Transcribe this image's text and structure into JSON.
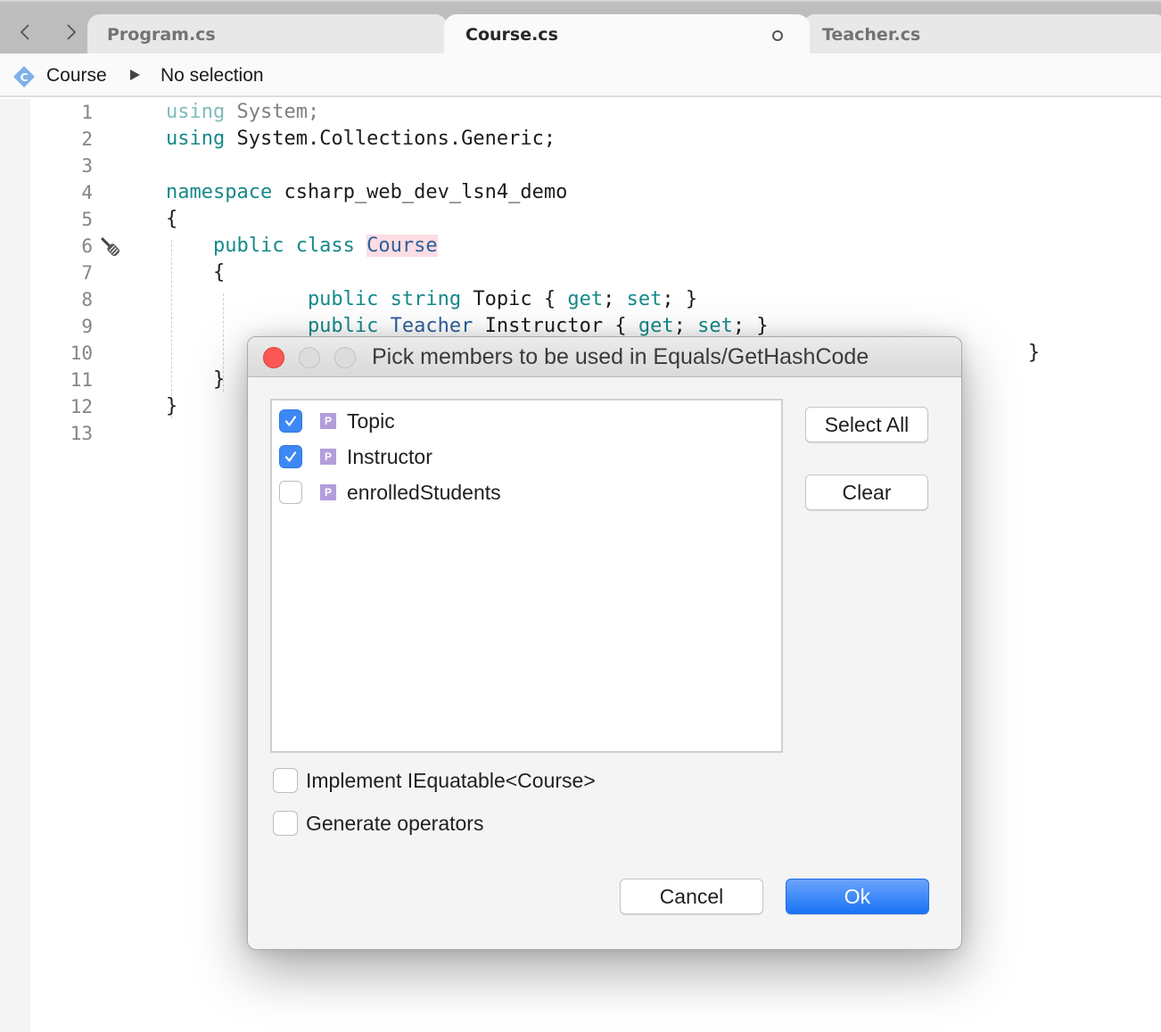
{
  "tabs": {
    "items": [
      {
        "label": "Program.cs",
        "active": false
      },
      {
        "label": "Course.cs",
        "active": true,
        "unsaved": true
      },
      {
        "label": "Teacher.cs",
        "active": false
      }
    ],
    "nav_back_icon": "chevron-left-icon",
    "nav_forward_icon": "chevron-right-icon"
  },
  "breadcrumb": {
    "class_icon_letter": "C",
    "class_name": "Course",
    "selection": "No selection"
  },
  "editor": {
    "line_numbers": [
      "1",
      "2",
      "3",
      "4",
      "5",
      "6",
      "7",
      "8",
      "9",
      "10",
      "11",
      "12",
      "13"
    ],
    "lines": [
      [
        {
          "t": "using",
          "c": "kw-dim"
        },
        {
          "t": " System;",
          "c": "dim"
        }
      ],
      [
        {
          "t": "using",
          "c": "kw"
        },
        {
          "t": " System.Collections.Generic;",
          "c": ""
        }
      ],
      [],
      [
        {
          "t": "namespace",
          "c": "kw"
        },
        {
          "t": " csharp_web_dev_lsn4_demo",
          "c": ""
        }
      ],
      [
        {
          "t": "{",
          "c": ""
        }
      ],
      [
        {
          "t": "    public class ",
          "c": "kw"
        },
        {
          "t": "Course",
          "c": "type hl"
        }
      ],
      [
        {
          "t": "    {",
          "c": ""
        }
      ],
      [
        {
          "t": "            public string",
          "c": "kw"
        },
        {
          "t": " Topic { ",
          "c": ""
        },
        {
          "t": "get",
          "c": "kw"
        },
        {
          "t": "; ",
          "c": ""
        },
        {
          "t": "set",
          "c": "kw"
        },
        {
          "t": "; }",
          "c": ""
        }
      ],
      [
        {
          "t": "            public ",
          "c": "kw"
        },
        {
          "t": "Teacher",
          "c": "type"
        },
        {
          "t": " Instructor { ",
          "c": ""
        },
        {
          "t": "get",
          "c": "kw"
        },
        {
          "t": "; ",
          "c": ""
        },
        {
          "t": "set",
          "c": "kw"
        },
        {
          "t": "; }",
          "c": ""
        }
      ],
      [
        {
          "t": "                                                                         }",
          "c": ""
        }
      ],
      [
        {
          "t": "    }",
          "c": ""
        }
      ],
      [
        {
          "t": "}",
          "c": ""
        }
      ],
      []
    ],
    "quick_fix_icon": "screwdriver-icon"
  },
  "dialog": {
    "title": "Pick members to be used in Equals/GetHashCode",
    "members": [
      {
        "label": "Topic",
        "checked": true,
        "kind": "P"
      },
      {
        "label": "Instructor",
        "checked": true,
        "kind": "P"
      },
      {
        "label": "enrolledStudents",
        "checked": false,
        "kind": "P"
      }
    ],
    "select_all_label": "Select All",
    "clear_label": "Clear",
    "options": [
      {
        "label": "Implement IEquatable<Course>",
        "checked": false
      },
      {
        "label": "Generate operators",
        "checked": false
      }
    ],
    "cancel_label": "Cancel",
    "ok_label": "Ok",
    "colors": {
      "accent": "#1a73f6",
      "checkbox_checked": "#3d88f5",
      "property_badge": "#b39ddb",
      "close_button": "#fc5753"
    }
  }
}
